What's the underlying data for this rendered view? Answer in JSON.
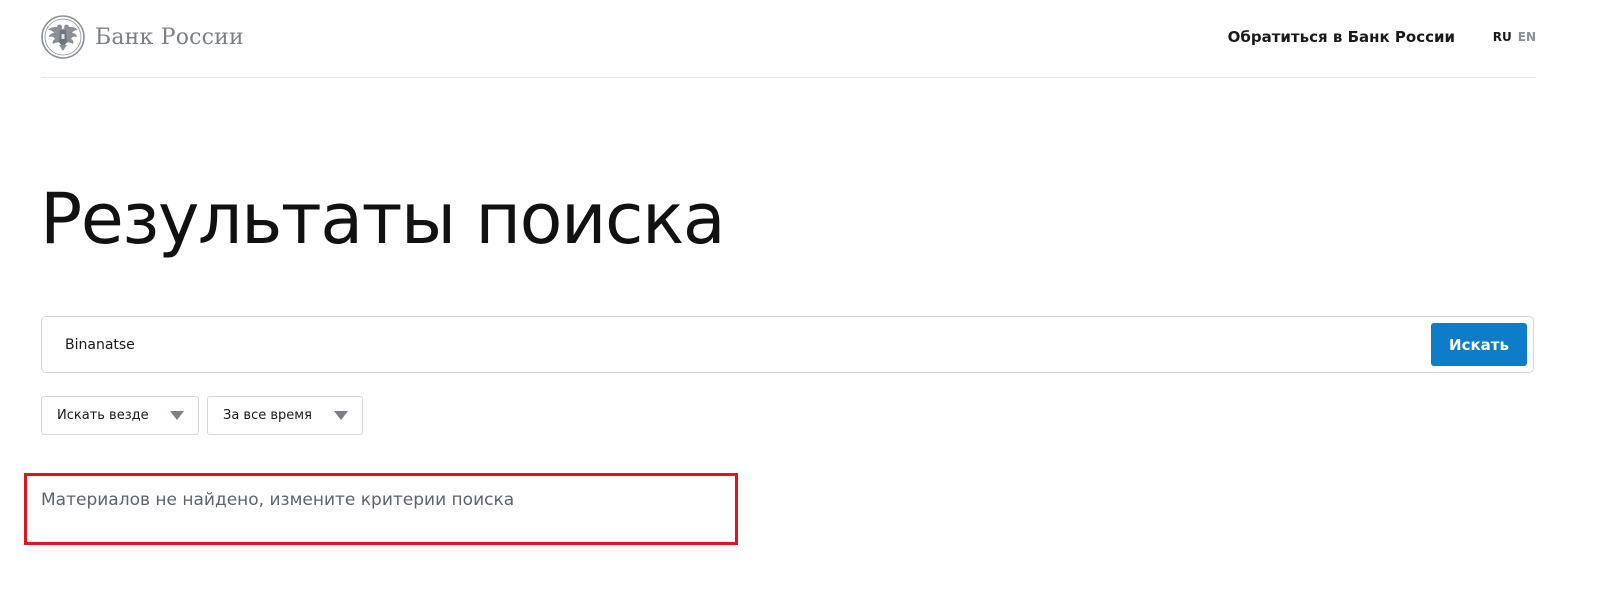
{
  "header": {
    "logo_text": "Банк России",
    "logo_icon": "eagle-emblem-icon",
    "contact_link": "Обратиться в Банк России",
    "languages": {
      "ru": "RU",
      "en": "EN",
      "active": "RU"
    }
  },
  "main": {
    "title": "Результаты поиска",
    "search": {
      "value": "Binanatse",
      "button_label": "Искать"
    },
    "filters": [
      {
        "label": "Искать везде"
      },
      {
        "label": "За все время"
      }
    ],
    "result_message": "Материалов не найдено, измените критерии поиска"
  },
  "colors": {
    "accent": "#0d7cc9",
    "highlight_frame": "#e0141e",
    "muted_text": "#5c6470",
    "logo_gray": "#7b8088"
  }
}
